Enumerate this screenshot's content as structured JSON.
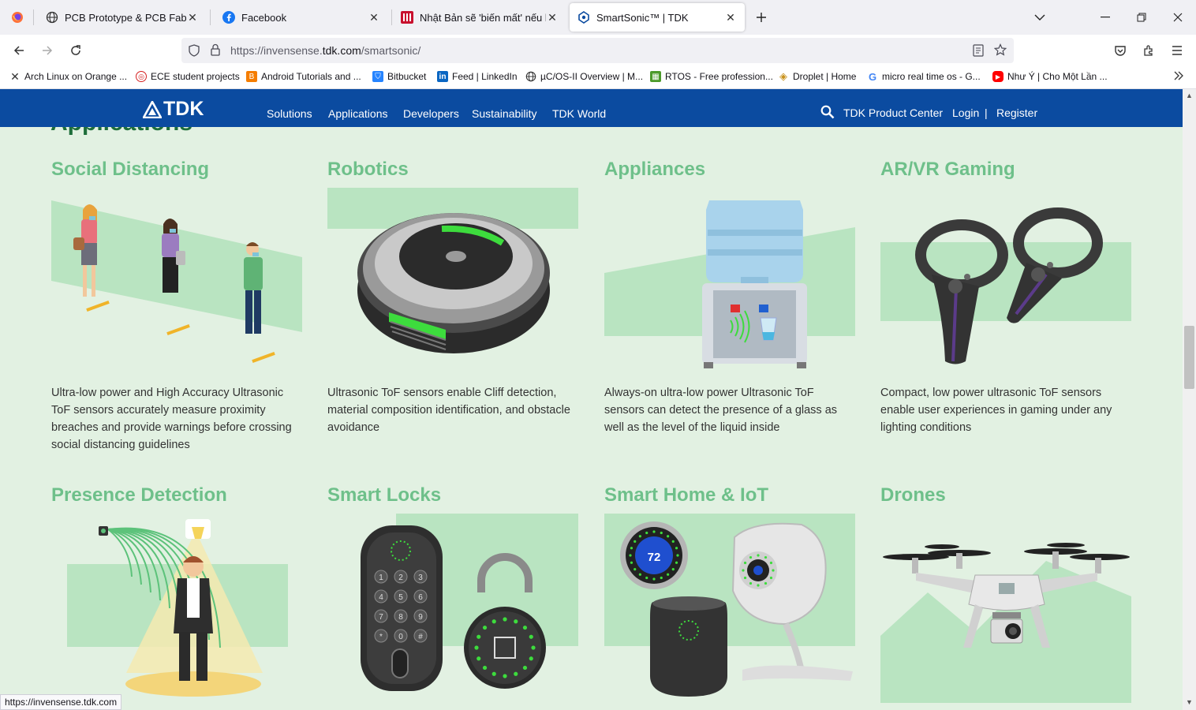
{
  "browser": {
    "tabs": [
      {
        "title": "PCB Prototype & PCB Fabricatio",
        "icon": "globe-icon"
      },
      {
        "title": "Facebook",
        "icon": "facebook-icon"
      },
      {
        "title": "Nhật Bản sẽ 'biến mất' nếu khô",
        "icon": "news-icon"
      },
      {
        "title": "SmartSonic™ | TDK",
        "icon": "tdk-icon"
      }
    ],
    "url_prefix": "https://invensense.",
    "url_domain": "tdk.com",
    "url_suffix": "/smartsonic/",
    "bookmarks": [
      "Arch Linux on Orange ...",
      "ECE student projects",
      "Android Tutorials and ...",
      "Bitbucket",
      "Feed | LinkedIn",
      "µC/OS-II Overview | M...",
      "RTOS - Free profession...",
      "Droplet | Home",
      "micro real time os - G...",
      "Như Ý | Cho Một Lần ..."
    ],
    "status_url": "https://invensense.tdk.com"
  },
  "site": {
    "logo": "TDK",
    "menu": [
      "Solutions",
      "Applications",
      "Developers",
      "Sustainability",
      "TDK World"
    ],
    "product_center": "TDK Product Center",
    "login": "Login",
    "separator": "|",
    "register": "Register"
  },
  "section_title": "Applications",
  "cards": [
    {
      "title": "Social Distancing",
      "desc": "Ultra-low power and High Accuracy Ultrasonic ToF sensors accurately measure proximity breaches and provide warnings before crossing social distancing guidelines"
    },
    {
      "title": "Robotics",
      "desc": "Ultrasonic ToF sensors enable Cliff detection, material composition identification, and obstacle avoidance"
    },
    {
      "title": "Appliances",
      "desc": "Always-on ultra-low power Ultrasonic ToF sensors can detect the presence of a glass as well as the level of the liquid inside"
    },
    {
      "title": "AR/VR Gaming",
      "desc": "Compact, low power ultrasonic ToF sensors enable user experiences in gaming under any lighting conditions"
    },
    {
      "title": "Presence Detection",
      "desc": ""
    },
    {
      "title": "Smart Locks",
      "desc": ""
    },
    {
      "title": "Smart Home & IoT",
      "desc": ""
    },
    {
      "title": "Drones",
      "desc": ""
    }
  ],
  "thermostat_value": "72",
  "keypad": [
    "1",
    "2",
    "3",
    "4",
    "5",
    "6",
    "7",
    "8",
    "9",
    "*",
    "0",
    "#"
  ],
  "colors": {
    "nav_blue": "#0b4ba0",
    "page_bg": "#e2f1e2",
    "accent_green": "#6ec08a",
    "panel_green": "#b9e4c1"
  }
}
